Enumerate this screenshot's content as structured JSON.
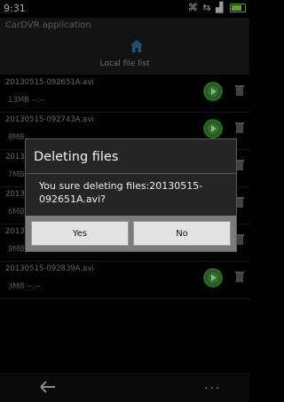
{
  "status_bar": {
    "time": "9:31",
    "icons": [
      "wifi-icon",
      "usb-icon",
      "signal-icon",
      "battery-icon"
    ]
  },
  "app": {
    "title": "CarDVR application"
  },
  "header": {
    "label": "Local file list",
    "icon": "home-icon"
  },
  "files": [
    {
      "name": "20130515-092651A.avi",
      "size": "13MB",
      "meta": "--:--"
    },
    {
      "name": "20130515-092743A.avi",
      "size": "8MB",
      "meta": ""
    },
    {
      "name": "2013",
      "size": "7MB",
      "meta": ""
    },
    {
      "name": "2013",
      "size": "6MB",
      "meta": ""
    },
    {
      "name": "2013",
      "size": "9MB",
      "meta": ""
    },
    {
      "name": "20130515-092839A.avi",
      "size": "3MB",
      "meta": "--:--"
    }
  ],
  "dialog": {
    "title": "Deleting files",
    "message": "You sure deleting files:20130515-092651A.avi?",
    "yes_label": "Yes",
    "no_label": "No"
  },
  "nav": {
    "more": "···"
  },
  "colors": {
    "play_green": "#3f9a36",
    "background": "#000000",
    "battery": "#7ddc3c"
  }
}
